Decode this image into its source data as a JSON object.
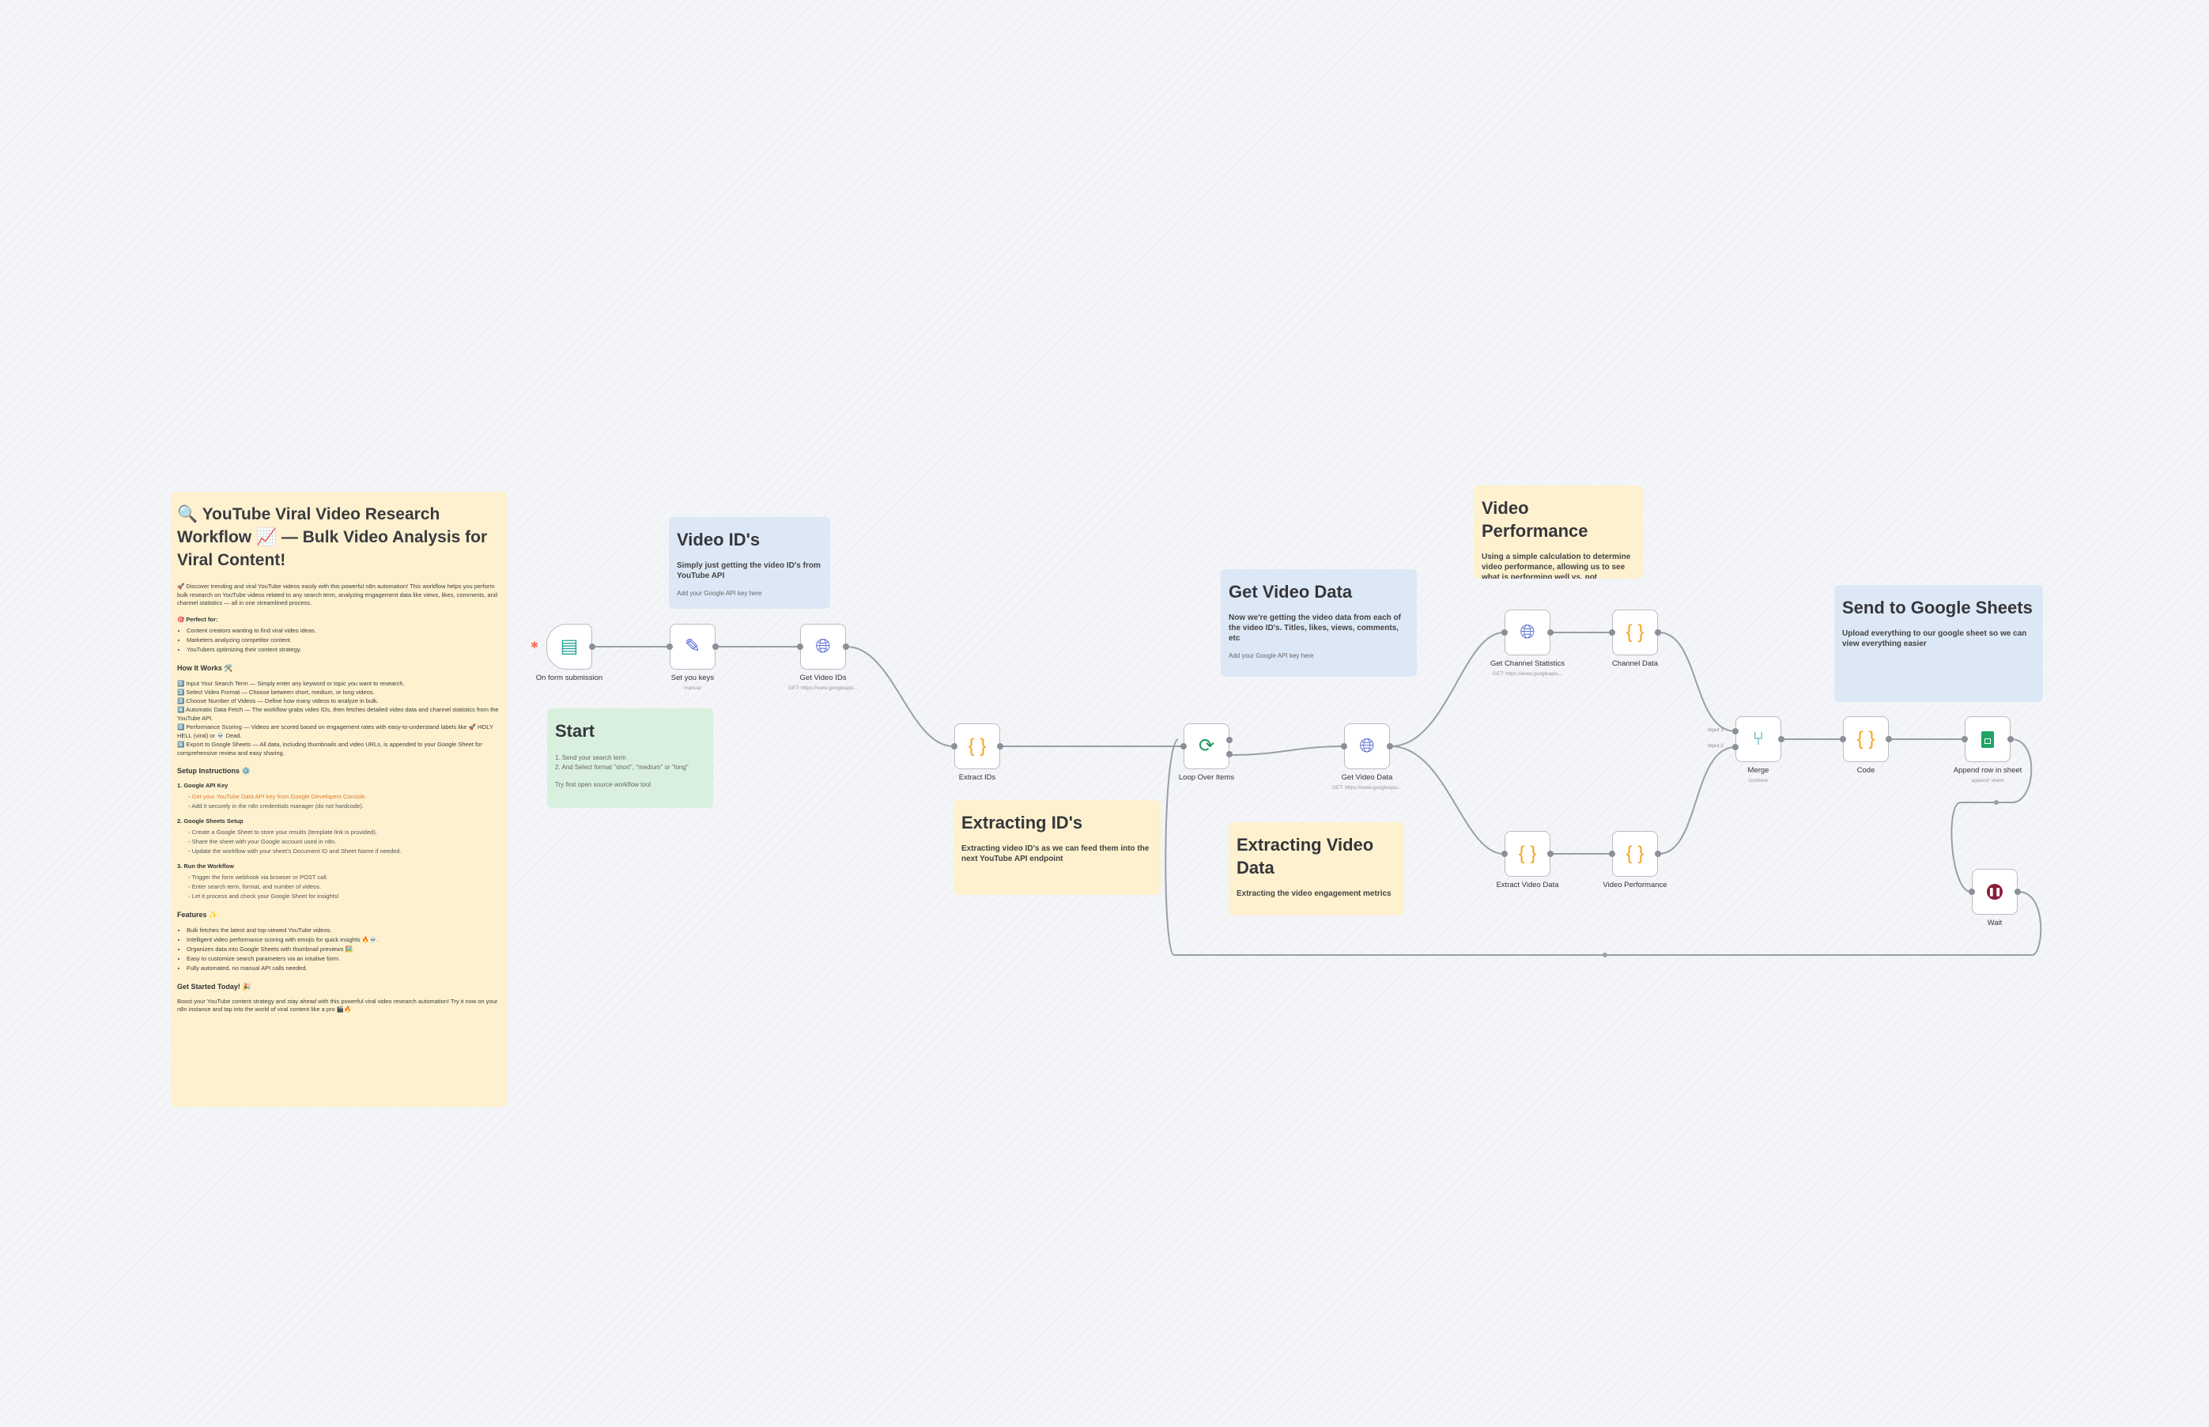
{
  "main_note": {
    "title": "🔍 YouTube Viral Video Research Workflow 📈 — Bulk Video Analysis for Viral Content!",
    "intro": "🚀 Discover trending and viral YouTube videos easily with this powerful n8n automation! This workflow helps you perform bulk research on YouTube videos related to any search term, analyzing engagement data like views, likes, comments, and channel statistics — all in one streamlined process.",
    "perfect_for_title": "🎯 Perfect for:",
    "perfect_for": [
      "Content creators wanting to find viral video ideas.",
      "Marketers analyzing competitor content.",
      "YouTubers optimizing their content strategy."
    ],
    "how_title": "How It Works 🛠️",
    "how_steps": [
      "1️⃣ Input Your Search Term — Simply enter any keyword or topic you want to research.",
      "2️⃣ Select Video Format — Choose between short, medium, or long videos.",
      "3️⃣ Choose Number of Videos — Define how many videos to analyze in bulk.",
      "4️⃣ Automatic Data Fetch — The workflow grabs video IDs, then fetches detailed video data and channel statistics from the YouTube API.",
      "5️⃣ Performance Scoring — Videos are scored based on engagement rates with easy-to-understand labels like 🚀 HOLY HELL (viral) or 💀 Dead.",
      "6️⃣ Export to Google Sheets — All data, including thumbnails and video URLs, is appended to your Google Sheet for comprehensive review and easy sharing."
    ],
    "setup_title": "Setup Instructions ⚙️",
    "setup_1_title": "1. Google API Key",
    "setup_1": [
      "Get your YouTube Data API key from Google Developers Console.",
      "Add it securely in the n8n credentials manager (do not hardcode)."
    ],
    "setup_2_title": "2. Google Sheets Setup",
    "setup_2": [
      "Create a Google Sheet to store your results (template link is provided).",
      "Share the sheet with your Google account used in n8n.",
      "Update the workflow with your sheet's Document ID and Sheet Name if needed."
    ],
    "setup_3_title": "3. Run the Workflow",
    "setup_3": [
      "Trigger the form webhook via browser or POST call.",
      "Enter search term, format, and number of videos.",
      "Let it process and check your Google Sheet for insights!"
    ],
    "features_title": "Features ✨",
    "features": [
      "Bulk fetches the latest and top-viewed YouTube videos.",
      "Intelligent video performance scoring with emojis for quick insights 🔥💀.",
      "Organizes data into Google Sheets with thumbnail previews 🖼️.",
      "Easy to customize search parameters via an intuitive form.",
      "Fully automated, no manual API calls needed."
    ],
    "started_title": "Get Started Today! 🎉",
    "started": "Boost your YouTube content strategy and stay ahead with this powerful viral video research automation! Try it now on your n8n instance and tap into the world of viral content like a pro 🎬🔥"
  },
  "notes": {
    "video_ids": {
      "title": "Video ID's",
      "body": "Simply just getting the video ID's from YouTube API",
      "sub": "Add your Google API key here"
    },
    "start": {
      "title": "Start",
      "line1": "1. Send your search term",
      "line2": "2. And Select format \"short\", \"medium\" or \"long\"",
      "sub": "Try first open source workflow tool"
    },
    "extracting_ids": {
      "title": "Extracting ID's",
      "body": "Extracting video ID's as we can feed them into the next YouTube API endpoint"
    },
    "get_video_data": {
      "title": "Get Video Data",
      "body": "Now we're getting the video data from each of the video ID's. Titles, likes, views, comments, etc",
      "sub": "Add your Google API key here"
    },
    "extracting_video_data": {
      "title": "Extracting Video Data",
      "body": "Extracting the video engagement metrics"
    },
    "video_performance": {
      "title": "Video Performance",
      "body": "Using a simple calculation to determine video performance, allowing us to see what is performing well vs. not"
    },
    "send_sheets": {
      "title": "Send to Google Sheets",
      "body": "Upload everything to our google sheet so we can view everything easier"
    }
  },
  "nodes": {
    "form": {
      "label": "On form submission",
      "icon": "form-icon"
    },
    "keys": {
      "label": "Set you keys",
      "sub": "manual",
      "icon": "pencil-icon"
    },
    "get_ids": {
      "label": "Get Video IDs",
      "sub": "GET: https://www.googleapis...",
      "icon": "globe-icon"
    },
    "extract_ids": {
      "label": "Extract IDs",
      "icon": "code-braces-icon"
    },
    "loop": {
      "label": "Loop Over Items",
      "icon": "loop-icon"
    },
    "get_video_data": {
      "label": "Get Video Data",
      "sub": "GET: https://www.googleapis...",
      "icon": "globe-icon"
    },
    "get_channel_stats": {
      "label": "Get Channel Statistics",
      "sub": "GET: https://www.googleapis...",
      "icon": "globe-icon"
    },
    "channel_data": {
      "label": "Channel Data",
      "icon": "code-braces-icon"
    },
    "extract_video_data": {
      "label": "Extract Video Data",
      "icon": "code-braces-icon"
    },
    "video_performance": {
      "label": "Video Performance",
      "icon": "code-braces-icon"
    },
    "merge": {
      "label": "Merge",
      "sub": "combine",
      "in1": "Input 1",
      "in2": "Input 2",
      "icon": "merge-icon"
    },
    "code": {
      "label": "Code",
      "icon": "code-braces-icon"
    },
    "append_sheet": {
      "label": "Append row in sheet",
      "sub": "append: sheet",
      "icon": "google-sheets-icon"
    },
    "wait": {
      "label": "Wait",
      "icon": "pause-icon"
    }
  },
  "colors": {
    "canvas": "#f4f5f8",
    "note_yellow": "#fdf1cf",
    "note_blue": "#dde8f6",
    "note_green": "#d9f0df",
    "wire": "#9a9ea7",
    "accent_orange": "#f5a21b",
    "globe_blue": "#5b6fd6",
    "sheets_green": "#1fa463",
    "wait_maroon": "#8b1d3a",
    "form_teal": "#24a39a"
  }
}
